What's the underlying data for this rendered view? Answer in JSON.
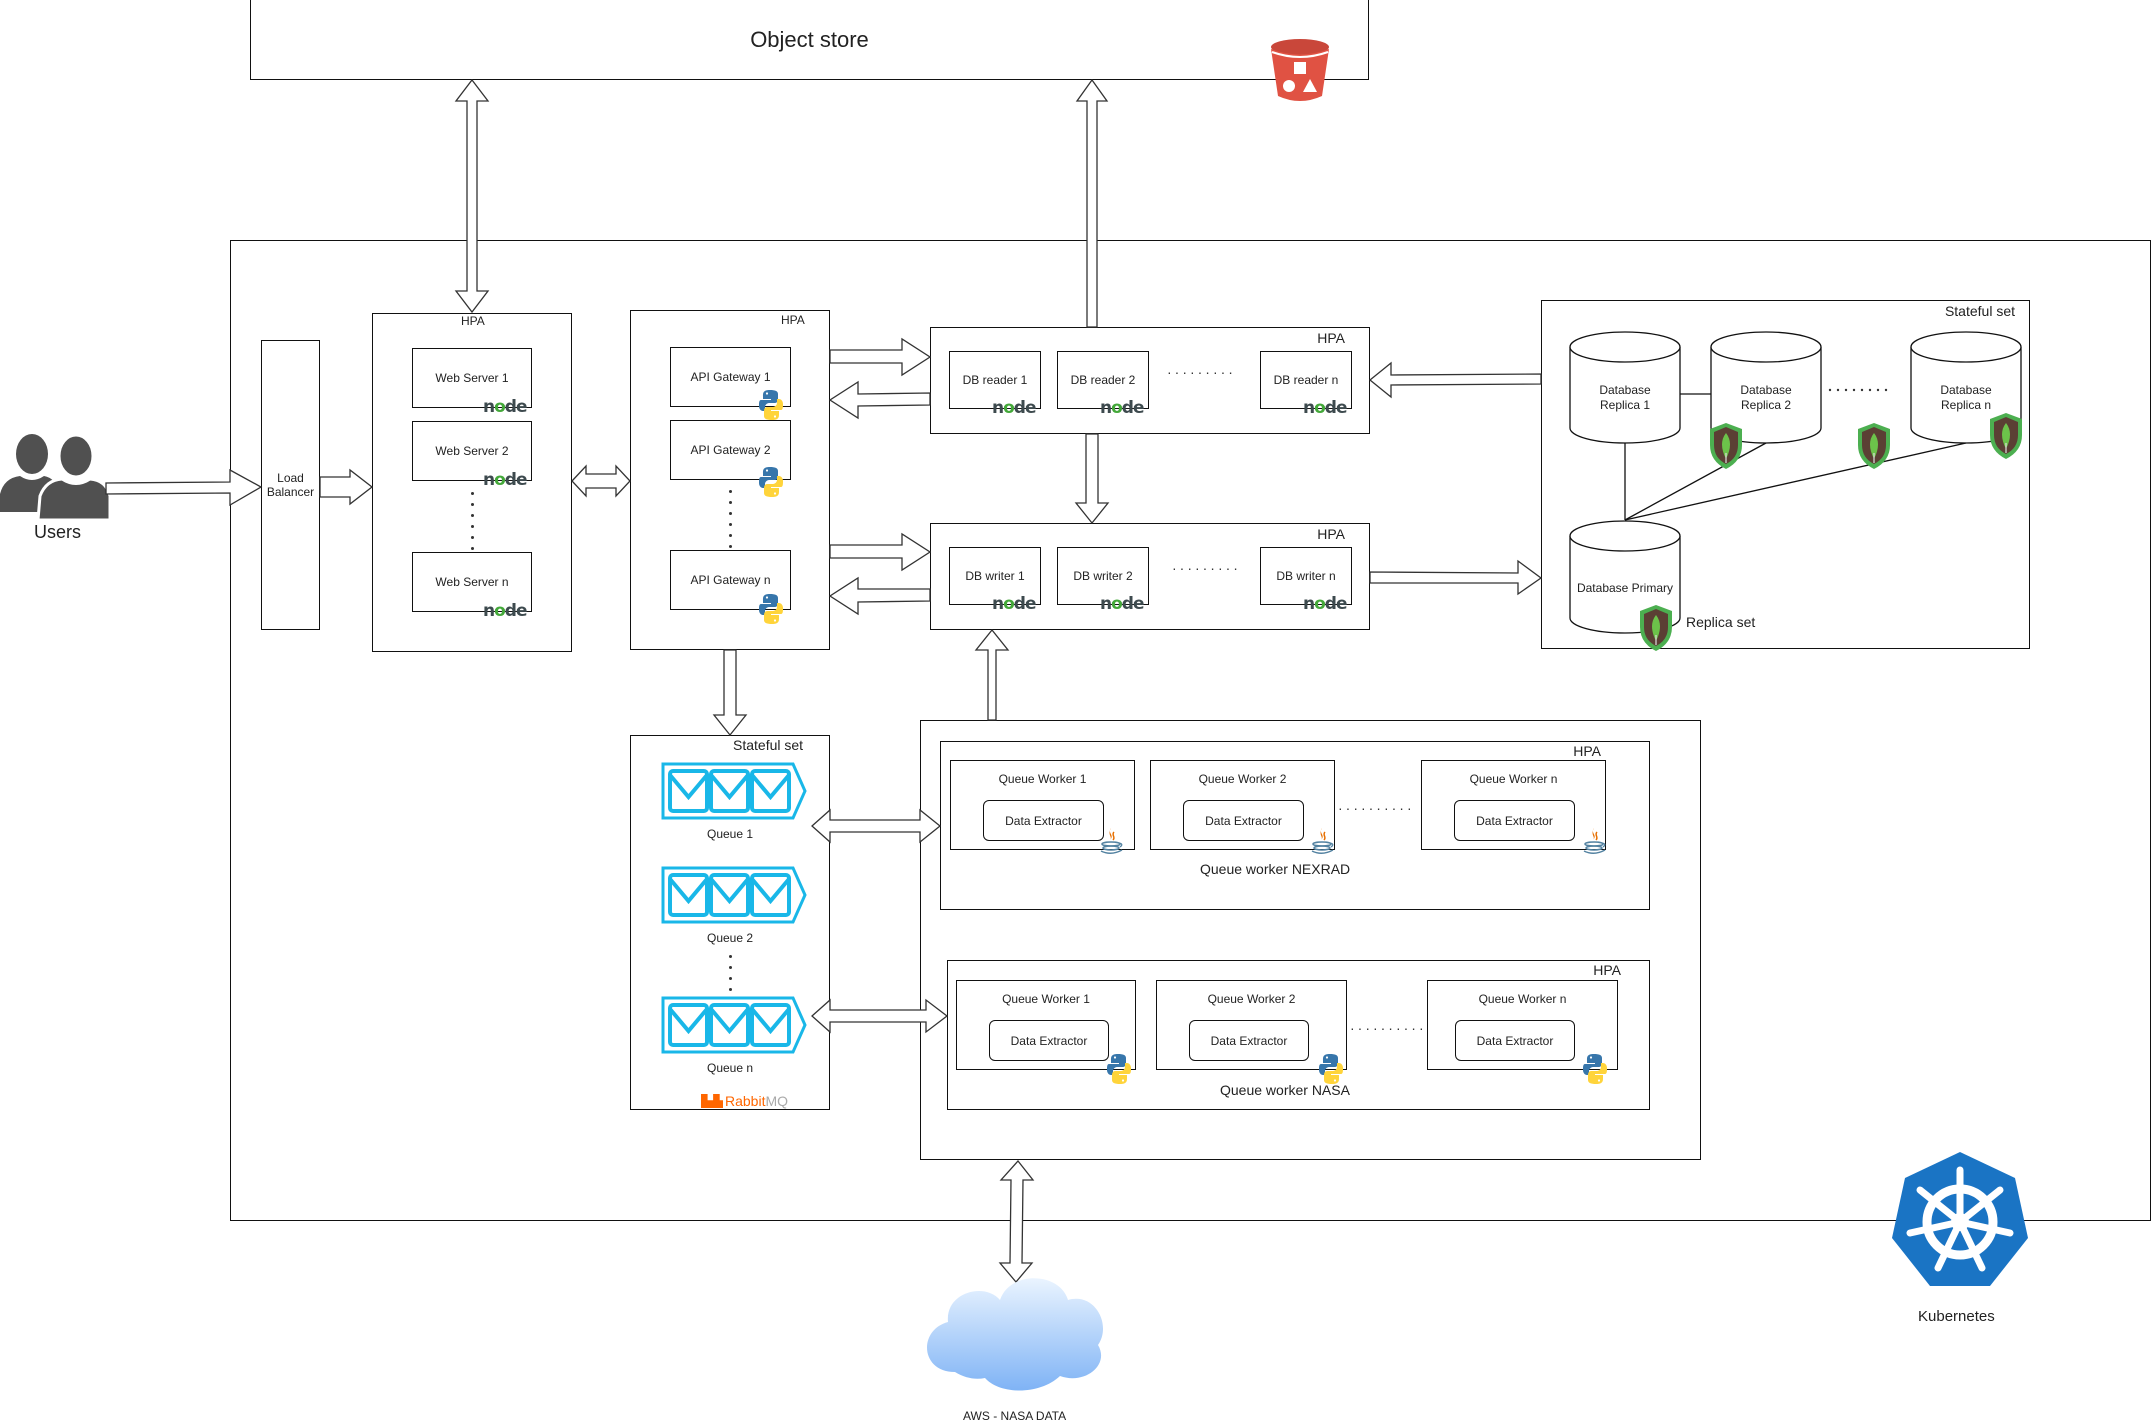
{
  "object_store": {
    "title": "Object store",
    "icon": "s3-bucket-icon",
    "icon_color": "#e05243"
  },
  "users": {
    "label": "Users",
    "icon": "users-icon"
  },
  "load_balancer": {
    "label_line1": "Load",
    "label_line2": "Balancer"
  },
  "web_tier": {
    "hpa_label": "HPA",
    "servers": [
      {
        "label": "Web Server 1",
        "runtime": "nodejs"
      },
      {
        "label": "Web Server 2",
        "runtime": "nodejs"
      },
      {
        "label": "Web Server n",
        "runtime": "nodejs"
      }
    ]
  },
  "api_tier": {
    "hpa_label": "HPA",
    "gateways": [
      {
        "label": "API Gateway 1",
        "runtime": "python"
      },
      {
        "label": "API Gateway 2",
        "runtime": "python"
      },
      {
        "label": "API Gateway n",
        "runtime": "python"
      }
    ]
  },
  "db_readers": {
    "hpa_label": "HPA",
    "items": [
      {
        "label": "DB reader 1",
        "runtime": "nodejs"
      },
      {
        "label": "DB reader 2",
        "runtime": "nodejs"
      },
      {
        "label": "DB reader n",
        "runtime": "nodejs"
      }
    ]
  },
  "db_writers": {
    "hpa_label": "HPA",
    "items": [
      {
        "label": "DB writer 1",
        "runtime": "nodejs"
      },
      {
        "label": "DB writer 2",
        "runtime": "nodejs"
      },
      {
        "label": "DB writer n",
        "runtime": "nodejs"
      }
    ]
  },
  "database": {
    "stateful_label": "Stateful set",
    "replica_set_label": "Replica set",
    "replicas": [
      {
        "line1": "Database",
        "line2": "Replica 1"
      },
      {
        "line1": "Database",
        "line2": "Replica 2"
      },
      {
        "line1": "Database",
        "line2": "Replica n"
      }
    ],
    "primary": "Database Primary",
    "engine": "mongodb"
  },
  "queues": {
    "stateful_label": "Stateful set",
    "items": [
      {
        "label": "Queue 1"
      },
      {
        "label": "Queue 2"
      },
      {
        "label": "Queue n"
      }
    ],
    "broker_brand": "Rabbit",
    "broker_brand_suffix": "MQ",
    "icon_color": "#19b7e8"
  },
  "workers_nexrad": {
    "hpa_label": "HPA",
    "group_label": "Queue worker NEXRAD",
    "runtime": "java",
    "workers": [
      {
        "label": "Queue Worker 1",
        "inner": "Data Extractor"
      },
      {
        "label": "Queue Worker 2",
        "inner": "Data Extractor"
      },
      {
        "label": "Queue Worker n",
        "inner": "Data Extractor"
      }
    ]
  },
  "workers_nasa": {
    "hpa_label": "HPA",
    "group_label": "Queue worker NASA",
    "runtime": "python",
    "workers": [
      {
        "label": "Queue Worker 1",
        "inner": "Data Extractor"
      },
      {
        "label": "Queue Worker 2",
        "inner": "Data Extractor"
      },
      {
        "label": "Queue Worker n",
        "inner": "Data Extractor"
      }
    ]
  },
  "external": {
    "label": "AWS - NASA DATA",
    "icon": "cloud-icon"
  },
  "platform": {
    "label": "Kubernetes",
    "icon": "kubernetes-icon",
    "color": "#1a74c4"
  },
  "node_logo": {
    "pre": "n",
    "mid": "o",
    "post": "de"
  }
}
